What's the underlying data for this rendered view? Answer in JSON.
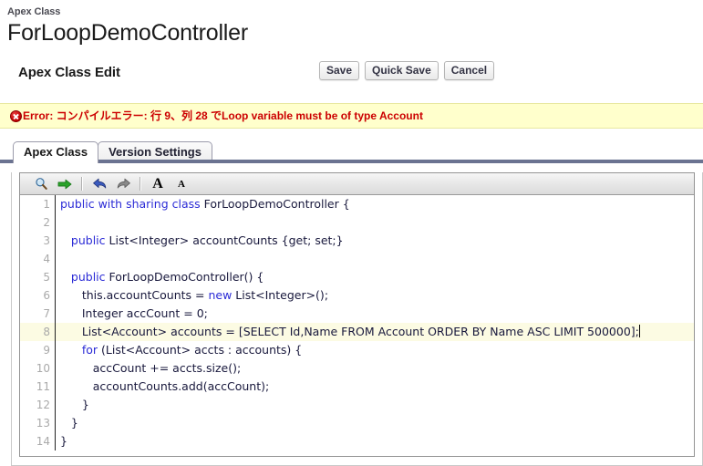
{
  "header": {
    "breadcrumb": "Apex Class",
    "title": "ForLoopDemoController"
  },
  "edit_section": {
    "title": "Apex Class Edit",
    "buttons": [
      {
        "label": "Save",
        "name": "save-button"
      },
      {
        "label": "Quick Save",
        "name": "quick-save-button"
      },
      {
        "label": "Cancel",
        "name": "cancel-button"
      }
    ]
  },
  "error": {
    "icon": "error-circle-icon",
    "text": "Error: コンパイルエラー: 行 9、列 28 でLoop variable must be of type Account",
    "color": "#cc0000",
    "background": "#ffffcc"
  },
  "tabs": [
    {
      "label": "Apex Class",
      "active": true
    },
    {
      "label": "Version Settings",
      "active": false
    }
  ],
  "editor_toolbar": {
    "buttons": [
      {
        "name": "search-icon",
        "title": "Find"
      },
      {
        "name": "go-to-line-arrow-icon",
        "title": "Go To"
      },
      {
        "name": "undo-icon",
        "title": "Undo"
      },
      {
        "name": "redo-icon",
        "title": "Redo"
      },
      {
        "name": "increase-font-size-icon",
        "label": "A"
      },
      {
        "name": "decrease-font-size-icon",
        "label": "A"
      }
    ]
  },
  "code": {
    "highlighted_line": 8,
    "caret_line": 8,
    "lines": [
      {
        "n": 1,
        "tokens": [
          {
            "t": "public with sharing class ",
            "c": "kw"
          },
          {
            "t": "ForLoopDemoController {",
            "c": "id"
          }
        ]
      },
      {
        "n": 2,
        "tokens": [
          {
            "t": "",
            "c": "id"
          }
        ]
      },
      {
        "n": 3,
        "tokens": [
          {
            "t": "   public ",
            "c": "kw"
          },
          {
            "t": "List<Integer> accountCounts {get; set;}",
            "c": "id"
          }
        ]
      },
      {
        "n": 4,
        "tokens": [
          {
            "t": "",
            "c": "id"
          }
        ]
      },
      {
        "n": 5,
        "tokens": [
          {
            "t": "   public ",
            "c": "kw"
          },
          {
            "t": "ForLoopDemoController() {",
            "c": "id"
          }
        ]
      },
      {
        "n": 6,
        "tokens": [
          {
            "t": "      this.accountCounts = ",
            "c": "id"
          },
          {
            "t": "new ",
            "c": "kw"
          },
          {
            "t": "List<Integer>();",
            "c": "id"
          }
        ]
      },
      {
        "n": 7,
        "tokens": [
          {
            "t": "      Integer accCount = 0;",
            "c": "id"
          }
        ]
      },
      {
        "n": 8,
        "tokens": [
          {
            "t": "      List<Account> accounts = [SELECT Id,Name FROM Account ORDER BY Name ASC LIMIT 500000];",
            "c": "id"
          }
        ]
      },
      {
        "n": 9,
        "tokens": [
          {
            "t": "      for ",
            "c": "kw"
          },
          {
            "t": "(List<Account> accts : accounts) {",
            "c": "id"
          }
        ]
      },
      {
        "n": 10,
        "tokens": [
          {
            "t": "         accCount += accts.size();",
            "c": "id"
          }
        ]
      },
      {
        "n": 11,
        "tokens": [
          {
            "t": "         accountCounts.add(accCount);",
            "c": "id"
          }
        ]
      },
      {
        "n": 12,
        "tokens": [
          {
            "t": "      }",
            "c": "id"
          }
        ]
      },
      {
        "n": 13,
        "tokens": [
          {
            "t": "   }",
            "c": "id"
          }
        ]
      },
      {
        "n": 14,
        "tokens": [
          {
            "t": "}",
            "c": "id"
          }
        ]
      }
    ]
  }
}
